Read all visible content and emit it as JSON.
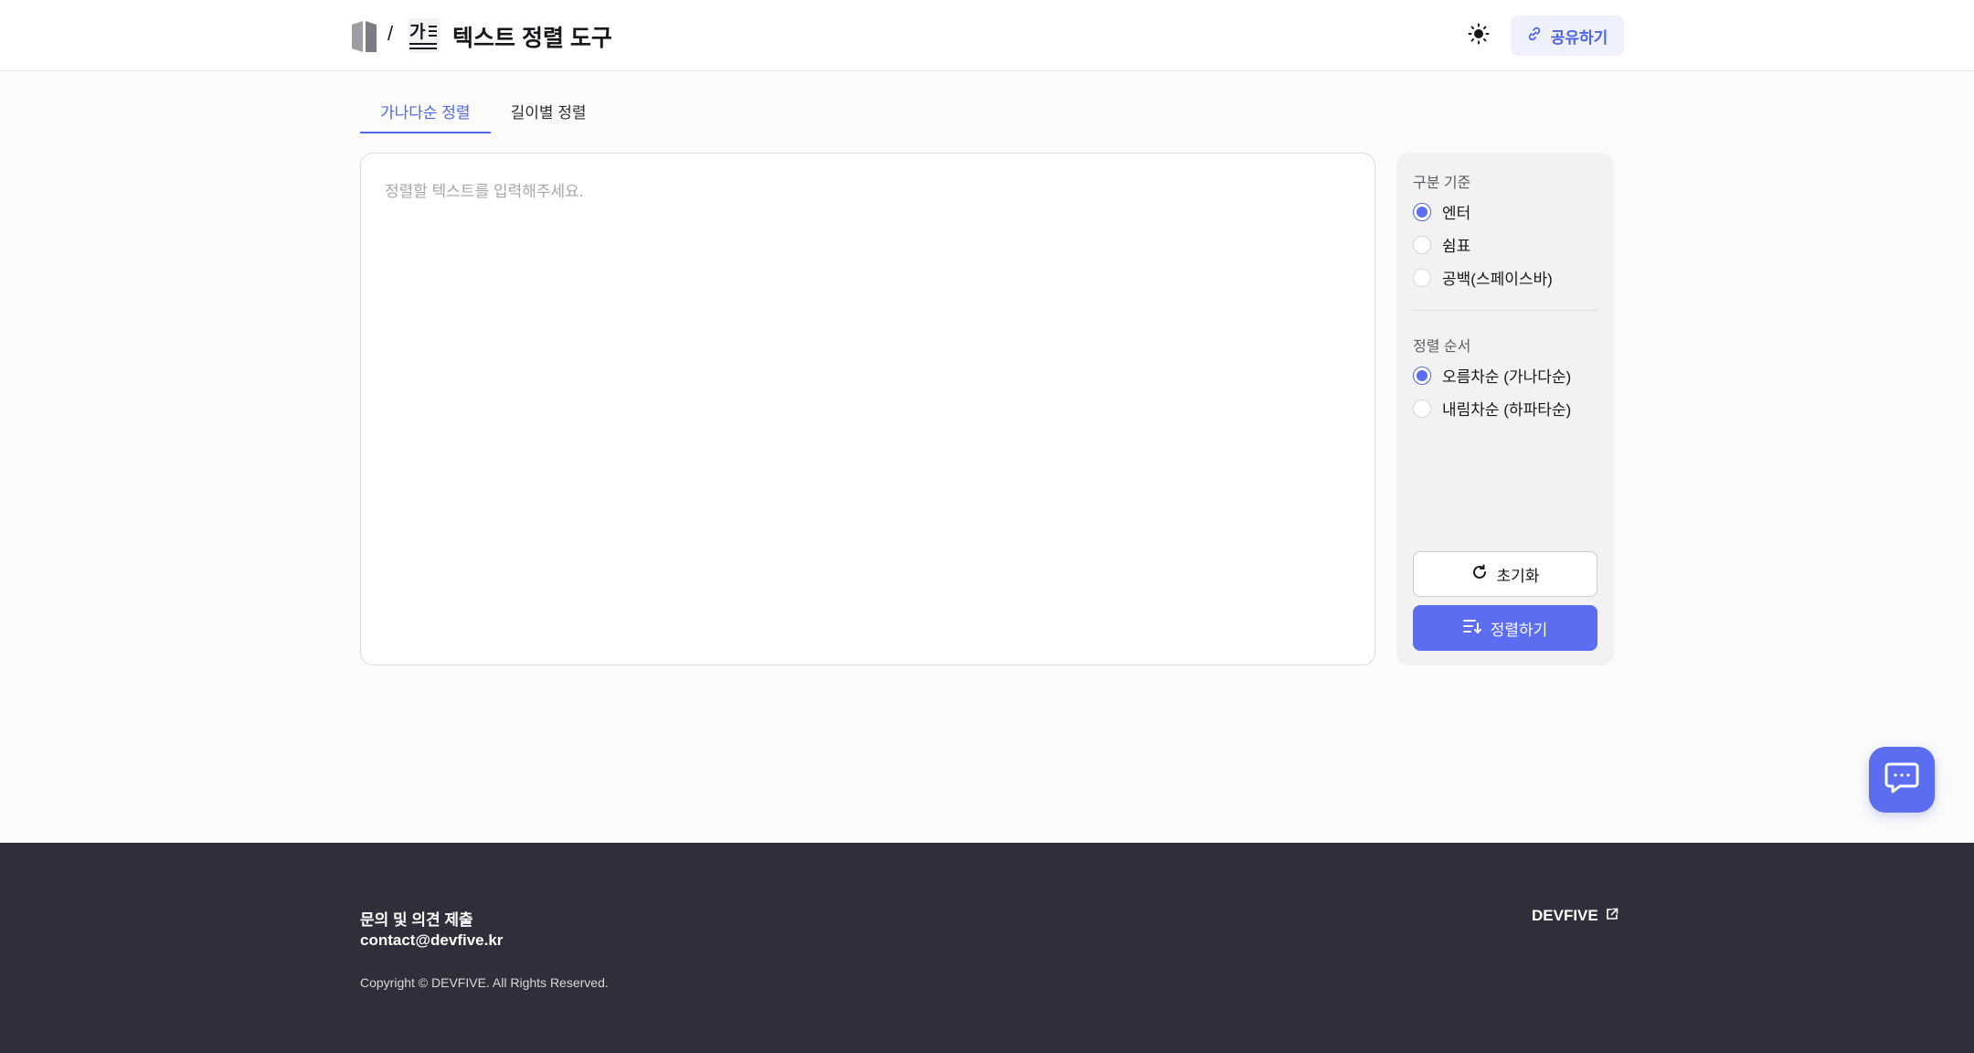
{
  "header": {
    "breadcrumb_separator": "/",
    "tool_icon_text": "가",
    "title": "텍스트 정렬 도구",
    "share_label": "공유하기"
  },
  "tabs": [
    {
      "label": "가나다순 정렬",
      "active": true
    },
    {
      "label": "길이별 정렬",
      "active": false
    }
  ],
  "editor": {
    "placeholder": "정렬할 텍스트를 입력해주세요.",
    "value": ""
  },
  "options": {
    "separator": {
      "title": "구분 기준",
      "choices": [
        {
          "label": "엔터",
          "checked": true
        },
        {
          "label": "쉼표",
          "checked": false
        },
        {
          "label": "공백(스페이스바)",
          "checked": false
        }
      ]
    },
    "order": {
      "title": "정렬 순서",
      "choices": [
        {
          "label": "오름차순 (가나다순)",
          "checked": true
        },
        {
          "label": "내림차순 (하파타순)",
          "checked": false
        }
      ]
    },
    "reset_label": "초기화",
    "sort_label": "정렬하기"
  },
  "footer": {
    "inquiry": "문의 및 의견 제출",
    "email": "contact@devfive.kr",
    "copyright": "Copyright © DEVFIVE. All Rights Reserved.",
    "company_link": "DEVFIVE"
  },
  "colors": {
    "accent": "#5b6ef0",
    "footer_bg": "#2e2f3a",
    "page_bg": "#fbfbfb"
  },
  "icons": {
    "brand": "book-logo-icon",
    "tool": "text-sort-icon",
    "theme": "sun-icon",
    "share": "link-icon",
    "reset": "refresh-icon",
    "sort": "sort-lines-icon",
    "chat": "chat-bubble-icon",
    "external": "external-link-icon"
  }
}
